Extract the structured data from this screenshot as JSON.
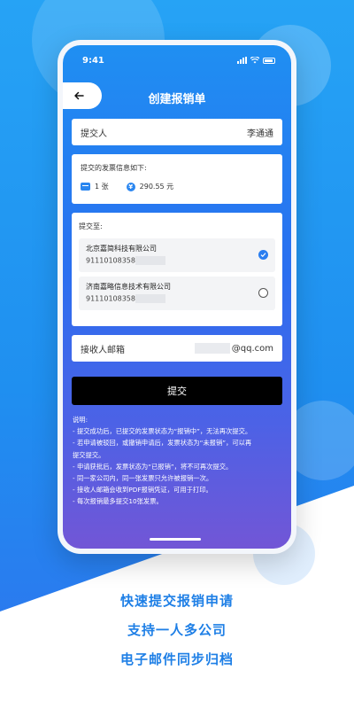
{
  "status_bar": {
    "time": "9:41"
  },
  "header": {
    "title": "创建报销单"
  },
  "submitter": {
    "label": "提交人",
    "value": "李通通"
  },
  "invoice_info": {
    "label": "提交的发票信息如下:",
    "count": "1 张",
    "amount": "290.55 元"
  },
  "submit_to": {
    "label": "提交至:",
    "companies": [
      {
        "name": "北京嘉简科技有限公司",
        "code": "91110108358",
        "selected": true
      },
      {
        "name": "济南嘉略信息技术有限公司",
        "code": "91110108358",
        "selected": false
      }
    ]
  },
  "email": {
    "label": "接收人邮箱",
    "suffix": "@qq.com"
  },
  "submit_button": {
    "label": "提交"
  },
  "notes": {
    "title": "说明:",
    "lines": [
      "- 提交成功后，已提交的发票状态为“报销中”，无法再次提交。",
      "- 若申请被驳回，或撤销申请后，发票状态为“未报销”，可以再",
      "提交提交。",
      "- 申请获批后，发票状态为“已报销”，将不可再次提交。",
      "- 同一家公司内，同一张发票只允许被报销一次。",
      "- 接收人邮箱会收到PDF报销凭证，可用于打印。",
      "- 每次报销最多提交10张发票。"
    ]
  },
  "taglines": [
    "快速提交报销申请",
    "支持一人多公司",
    "电子邮件同步归档"
  ],
  "colors": {
    "accent": "#2a7ef0",
    "tagline": "#1e7fe6",
    "button": "#000000"
  }
}
